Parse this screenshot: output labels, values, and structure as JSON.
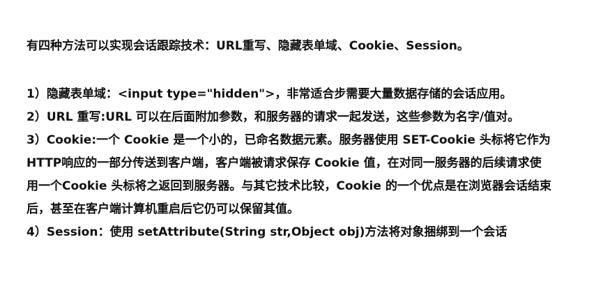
{
  "document": {
    "intro": "有四种方法可以实现会话跟踪技术：URL重写、隐藏表单域、Cookie、Session。",
    "lines": [
      "1）隐藏表单域：<input type=\"hidden\">，非常适合步需要大量数据存储的会话应用。",
      "2）URL 重写:URL 可以在后面附加参数，和服务器的请求一起发送，这些参数为名字/值对。",
      "3）Cookie:一个 Cookie 是一个小的，已命名数据元素。服务器使用 SET-Cookie 头标将它作为",
      "HTTP响应的一部分传送到客户端，客户端被请求保存 Cookie 值，在对同一服务器的后续请求使",
      "用一个Cookie 头标将之返回到服务器。与其它技术比较，Cookie 的一个优点是在浏览器会话结束",
      "后，甚至在客户端计算机重启后它仍可以保留其值。",
      "4）Session：使用 setAttribute(String str,Object obj)方法将对象捆绑到一个会话"
    ]
  }
}
